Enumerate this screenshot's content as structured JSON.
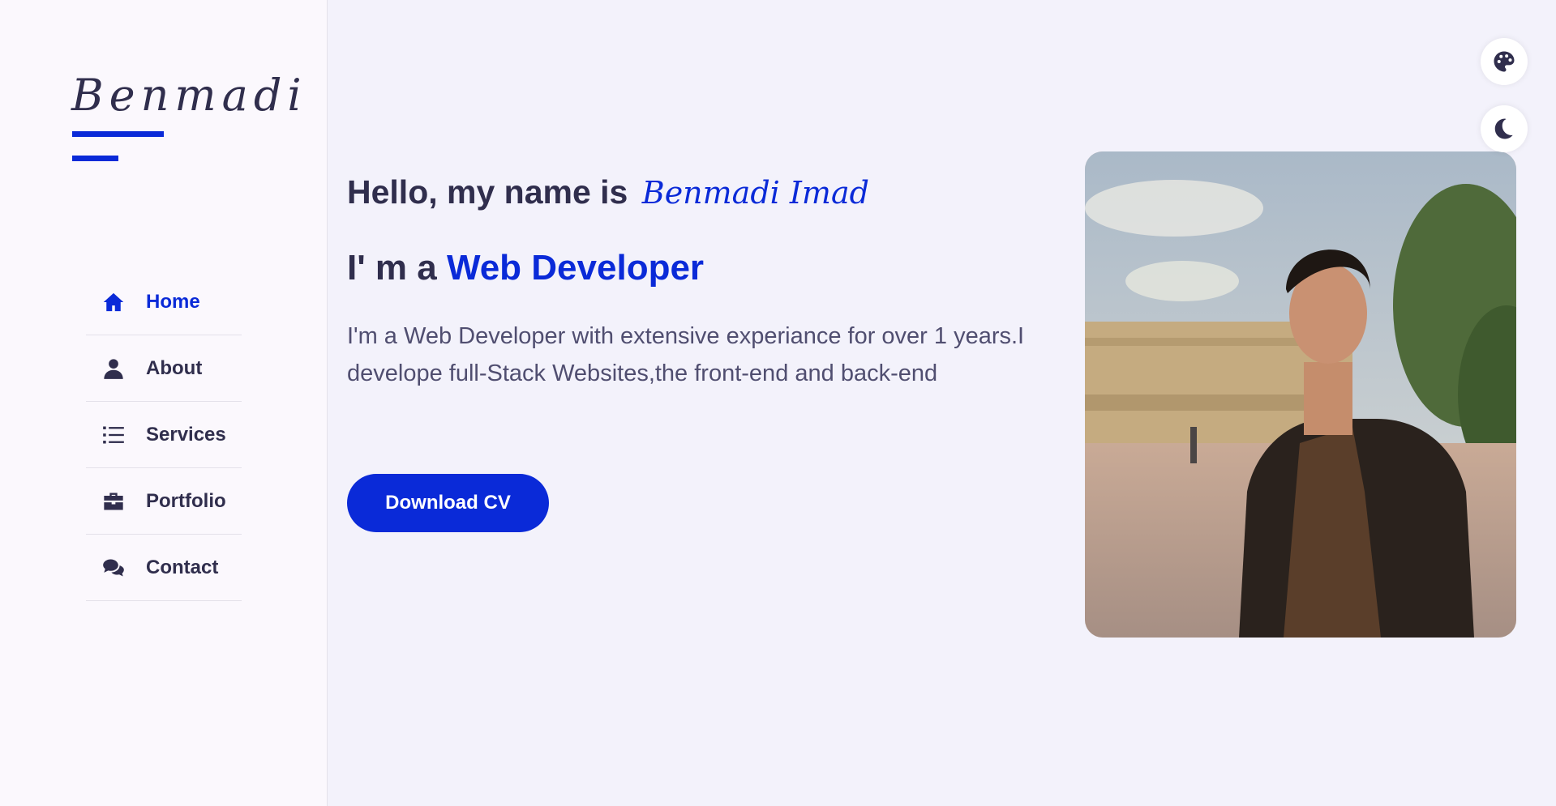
{
  "brand": {
    "logo_text": "Benmadi",
    "accent_color": "#0a2ad8",
    "text_color": "#302e4d"
  },
  "nav": {
    "items": [
      {
        "label": "Home",
        "icon": "home-icon",
        "active": true
      },
      {
        "label": "About",
        "icon": "user-icon",
        "active": false
      },
      {
        "label": "Services",
        "icon": "list-icon",
        "active": false
      },
      {
        "label": "Portfolio",
        "icon": "briefcase-icon",
        "active": false
      },
      {
        "label": "Contact",
        "icon": "comments-icon",
        "active": false
      }
    ]
  },
  "hero": {
    "greeting": "Hello, my name is",
    "name": "Benmadi Imad",
    "role_prefix": "I' m a",
    "role": "Web Developer",
    "description": "I'm a Web Developer with extensive experiance for over 1 years.I develope full-Stack Websites,the front-end and back-end",
    "cta_label": "Download CV"
  },
  "controls": {
    "style_switcher_icon": "palette-icon",
    "theme_toggle_icon": "moon-icon"
  },
  "photo": {
    "alt": "profile-photo"
  }
}
